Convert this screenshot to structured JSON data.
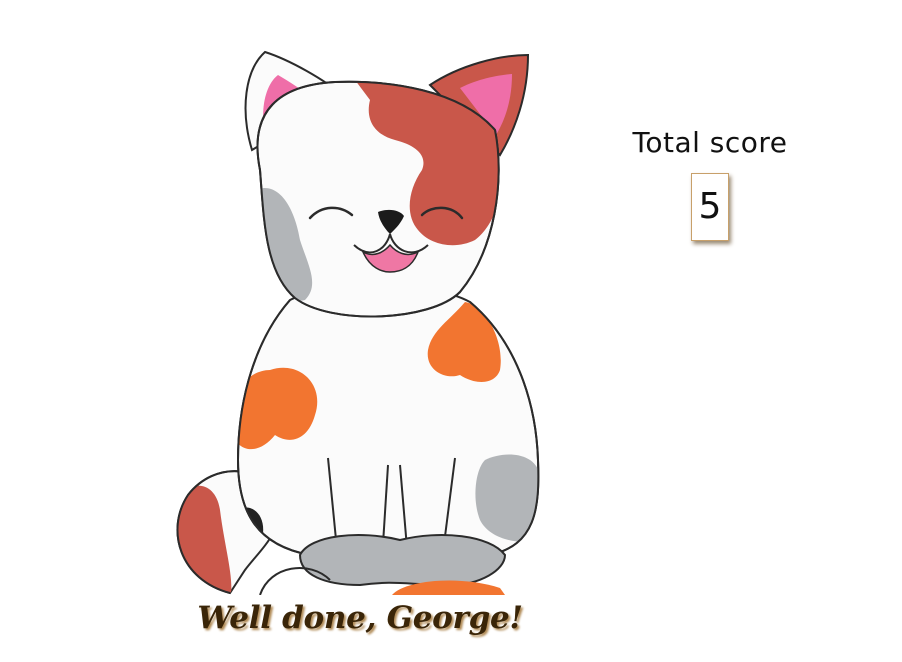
{
  "score": {
    "label": "Total score",
    "value": "5"
  },
  "message": "Well done, George!",
  "illustration": {
    "subject": "cat-icon",
    "colors": {
      "outline": "#2b2b2b",
      "white_fur": "#fbfbfb",
      "red_patch": "#c9574a",
      "orange_patch": "#f27530",
      "grey_patch": "#b2b5b8",
      "ear_inner": "#ef6ea8",
      "tongue": "#ef77a4"
    }
  }
}
